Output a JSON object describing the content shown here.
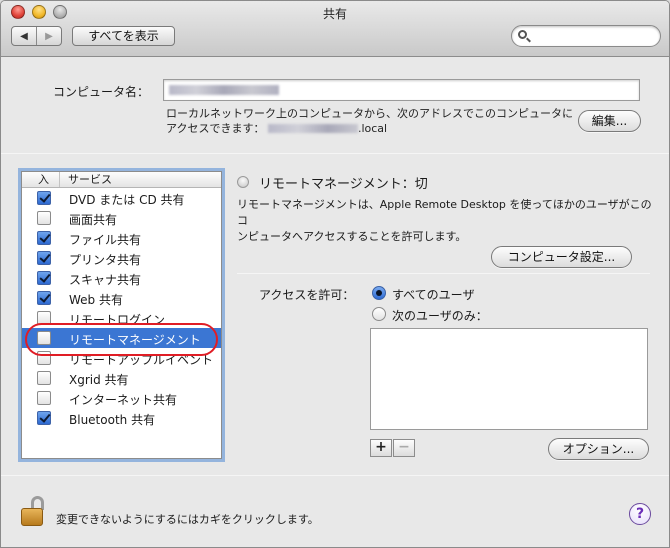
{
  "window": {
    "title": "共有"
  },
  "toolbar": {
    "back_glyph": "◀",
    "forward_glyph": "▶",
    "show_all_label": "すべてを表示",
    "search_placeholder": ""
  },
  "computer_name": {
    "label": "コンピュータ名：",
    "value": "",
    "description_line1": "ローカルネットワーク上のコンピュータから、次のアドレスでこのコンピュータに",
    "description_line2_prefix": "アクセスできます：",
    "description_line2_suffix": ".local",
    "edit_button": "編集..."
  },
  "services": {
    "header_on": "入",
    "header_service": "サービス",
    "items": [
      {
        "label": "DVD または CD 共有",
        "checked": true
      },
      {
        "label": "画面共有",
        "checked": false
      },
      {
        "label": "ファイル共有",
        "checked": true
      },
      {
        "label": "プリンタ共有",
        "checked": true
      },
      {
        "label": "スキャナ共有",
        "checked": true
      },
      {
        "label": "Web 共有",
        "checked": true
      },
      {
        "label": "リモートログイン",
        "checked": false
      },
      {
        "label": "リモートマネージメント",
        "checked": false,
        "selected": true
      },
      {
        "label": "リモートアップルイベント",
        "checked": false
      },
      {
        "label": "Xgrid 共有",
        "checked": false
      },
      {
        "label": "インターネット共有",
        "checked": false
      },
      {
        "label": "Bluetooth 共有",
        "checked": true
      }
    ]
  },
  "detail": {
    "status": "リモートマネージメント：切",
    "description_line1": "リモートマネージメントは、Apple Remote Desktop を使ってほかのユーザがこのコ",
    "description_line2": "ンピュータへアクセスすることを許可します。",
    "computer_settings_button": "コンピュータ設定...",
    "access_label": "アクセスを許可：",
    "radio_all_users": "すべてのユーザ",
    "radio_only_users": "次のユーザのみ：",
    "add_glyph": "+",
    "remove_glyph": "−",
    "options_button": "オプション..."
  },
  "footer": {
    "lock_text": "変更できないようにするにはカギをクリックします。",
    "help_glyph": "?"
  },
  "colors": {
    "selection": "#3b76d3",
    "highlight_ring": "#e01d25",
    "focus_ring": "#4f88d3"
  }
}
